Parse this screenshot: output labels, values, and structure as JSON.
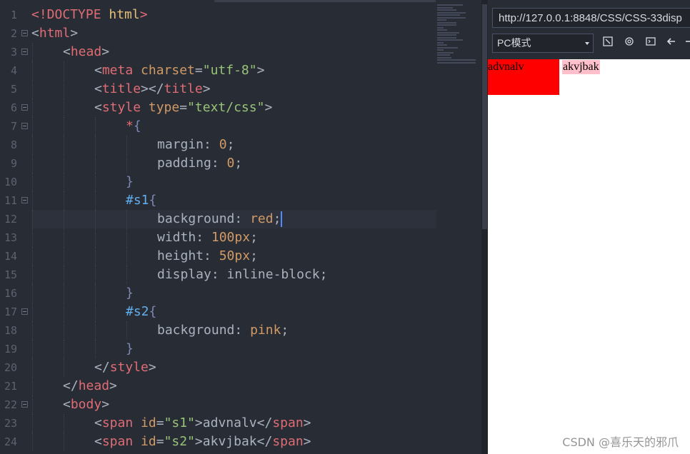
{
  "editor": {
    "lines": [
      {
        "n": "1",
        "fold": false
      },
      {
        "n": "2",
        "fold": true
      },
      {
        "n": "3",
        "fold": true
      },
      {
        "n": "4",
        "fold": false
      },
      {
        "n": "5",
        "fold": false
      },
      {
        "n": "6",
        "fold": true
      },
      {
        "n": "7",
        "fold": true
      },
      {
        "n": "8",
        "fold": false
      },
      {
        "n": "9",
        "fold": false
      },
      {
        "n": "10",
        "fold": false
      },
      {
        "n": "11",
        "fold": true
      },
      {
        "n": "12",
        "fold": false
      },
      {
        "n": "13",
        "fold": false
      },
      {
        "n": "14",
        "fold": false
      },
      {
        "n": "15",
        "fold": false
      },
      {
        "n": "16",
        "fold": false
      },
      {
        "n": "17",
        "fold": true
      },
      {
        "n": "18",
        "fold": false
      },
      {
        "n": "19",
        "fold": false
      },
      {
        "n": "20",
        "fold": false
      },
      {
        "n": "21",
        "fold": false
      },
      {
        "n": "22",
        "fold": true
      },
      {
        "n": "23",
        "fold": false
      },
      {
        "n": "24",
        "fold": false
      }
    ],
    "code": {
      "l1": [
        "<!DOCTYPE",
        " html",
        ">"
      ],
      "l2": [
        "<",
        "html",
        ">"
      ],
      "l3": [
        "<",
        "head",
        ">"
      ],
      "l4": [
        "<",
        "meta",
        " charset",
        "=",
        "\"utf-8\"",
        ">"
      ],
      "l5": [
        "<",
        "title",
        "></",
        "title",
        ">"
      ],
      "l6": [
        "<",
        "style",
        " type",
        "=",
        "\"text/css\"",
        ">"
      ],
      "l7": [
        "*",
        "{"
      ],
      "l8": [
        "margin",
        ": ",
        "0",
        ";"
      ],
      "l9": [
        "padding",
        ": ",
        "0",
        ";"
      ],
      "l10": [
        "}"
      ],
      "l11": [
        "#s1",
        "{"
      ],
      "l12": [
        "background",
        ": ",
        "red",
        ";"
      ],
      "l13": [
        "width",
        ": ",
        "100px",
        ";"
      ],
      "l14": [
        "height",
        ": ",
        "50px",
        ";"
      ],
      "l15": [
        "display",
        ": ",
        "inline-block",
        ";"
      ],
      "l16": [
        "}"
      ],
      "l17": [
        "#s2",
        "{"
      ],
      "l18": [
        "background",
        ": ",
        "pink",
        ";"
      ],
      "l19": [
        "}"
      ],
      "l20": [
        "</",
        "style",
        ">"
      ],
      "l21": [
        "</",
        "head",
        ">"
      ],
      "l22": [
        "<",
        "body",
        ">"
      ],
      "l23": [
        "<",
        "span",
        " id",
        "=",
        "\"s1\"",
        ">",
        "advnalv",
        "</",
        "span",
        ">"
      ],
      "l24": [
        "<",
        "span",
        " id",
        "=",
        "\"s2\"",
        ">",
        "akvjbak",
        "</",
        "span",
        ">"
      ]
    }
  },
  "browser": {
    "url": "http://127.0.0.1:8848/CSS/CSS-33disp",
    "mode": "PC模式",
    "s1_text": "advnalv",
    "s2_text": "akvjbak",
    "icons": [
      "screenshot-icon",
      "settings-icon",
      "console-icon",
      "back-arrow-icon",
      "forward-arrow-icon"
    ]
  },
  "colors": {
    "s1_background": "#ff0000",
    "s2_background": "#ffc0cb",
    "editor_background": "#282c34"
  },
  "watermark": "CSDN @喜乐天的邪爪"
}
